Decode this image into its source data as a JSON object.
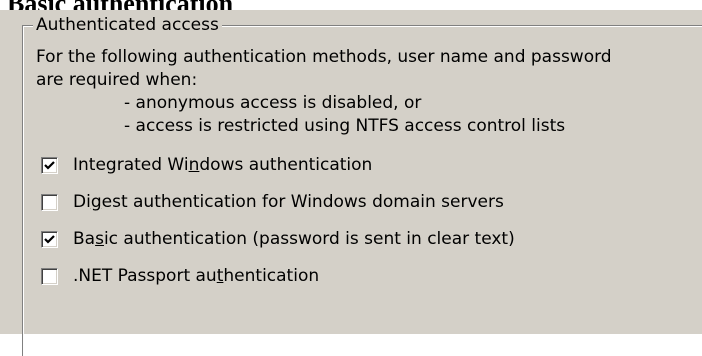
{
  "page": {
    "heading": "Basic authentication"
  },
  "group": {
    "title": "Authenticated access",
    "description_line1": "For the following authentication methods, user name and password",
    "description_line2": "are required when:",
    "condition1": "- anonymous access is disabled, or",
    "condition2": "- access is restricted using NTFS access control lists"
  },
  "checkboxes": [
    {
      "before": "Integrated Wi",
      "mnemonic": "n",
      "after": "dows authentication",
      "checked": true
    },
    {
      "before": "Di",
      "mnemonic": "g",
      "after": "est authentication for Windows domain servers",
      "checked": false
    },
    {
      "before": "Ba",
      "mnemonic": "s",
      "after": "ic authentication (password is sent in clear text)",
      "checked": true
    },
    {
      "before": ".NET Passport au",
      "mnemonic": "t",
      "after": "hentication",
      "checked": false
    }
  ],
  "colors": {
    "dialog_background": "#d4d0c8",
    "checkmark": "#000000"
  },
  "icons": {
    "checkmark": "checkmark-icon"
  }
}
